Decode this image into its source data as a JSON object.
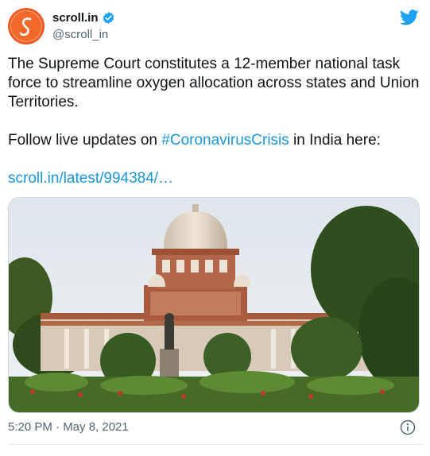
{
  "account": {
    "display_name": "scroll.in",
    "handle": "@scroll_in",
    "verified": true,
    "avatar_glyph": "S",
    "avatar_color": "#ee5a24"
  },
  "tweet": {
    "text_line1": "The Supreme Court constitutes a 12-member national task force to streamline oxygen allocation across states and Union Territories.",
    "text_line2_before": "Follow live updates on ",
    "hashtag": "#CoronavirusCrisis",
    "text_line2_after": " in India here:",
    "link": "scroll.in/latest/994384/…",
    "link_color": "#1b95e0"
  },
  "media": {
    "icon": "photo-supreme-court-building"
  },
  "footer": {
    "timestamp": "5:20 PM · May 8, 2021"
  },
  "icons": {
    "brand": "twitter-bird-icon",
    "verified": "verified-badge-icon",
    "info": "info-icon",
    "brand_color": "#1da1f2"
  }
}
